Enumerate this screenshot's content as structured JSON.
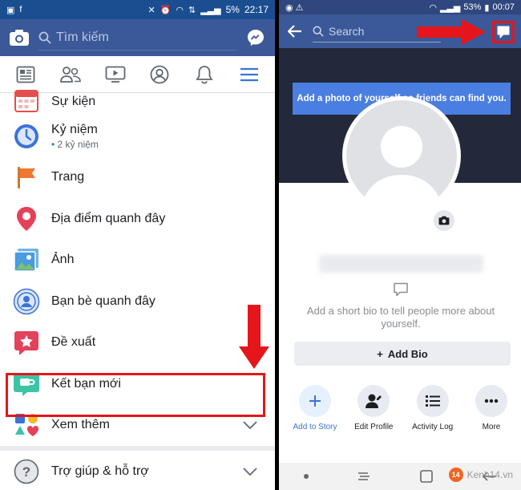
{
  "left": {
    "status_bar": {
      "battery": "5%",
      "time": "22:17"
    },
    "search": {
      "placeholder": "Tìm kiếm"
    },
    "tabs": [
      "news-feed-icon",
      "friends-icon",
      "watch-icon",
      "profile-icon",
      "notifications-icon",
      "menu-icon"
    ],
    "menu_items": [
      {
        "label": "Sự kiện",
        "sub": ""
      },
      {
        "label": "Kỷ niệm",
        "sub": "2 kỷ niệm"
      },
      {
        "label": "Trang",
        "sub": ""
      },
      {
        "label": "Địa điểm quanh đây",
        "sub": ""
      },
      {
        "label": "Ảnh",
        "sub": ""
      },
      {
        "label": "Bạn bè quanh đây",
        "sub": ""
      },
      {
        "label": "Đề xuất",
        "sub": ""
      },
      {
        "label": "Kết bạn mới",
        "sub": ""
      },
      {
        "label": "Xem thêm",
        "sub": ""
      },
      {
        "label": "Trợ giúp & hỗ trợ",
        "sub": ""
      }
    ],
    "highlight_color": "#e4161b"
  },
  "right": {
    "status_bar": {
      "battery": "53%",
      "time": "00:07"
    },
    "search": {
      "placeholder": "Search"
    },
    "tooltip": "Add a photo of yourself so friends can find you.",
    "bio_prompt": "Add a short bio to tell people more about yourself.",
    "add_bio_label": "Add Bio",
    "actions": [
      {
        "label": "Add to Story",
        "icon": "plus-icon"
      },
      {
        "label": "Edit Profile",
        "icon": "edit-profile-icon"
      },
      {
        "label": "Activity Log",
        "icon": "list-icon"
      },
      {
        "label": "More",
        "icon": "more-icon"
      }
    ],
    "watermark": "Kenh14.vn",
    "watermark_badge": "14"
  },
  "colors": {
    "brand": "#3b5998",
    "accent": "#1877f2",
    "highlight": "#e4161b"
  }
}
